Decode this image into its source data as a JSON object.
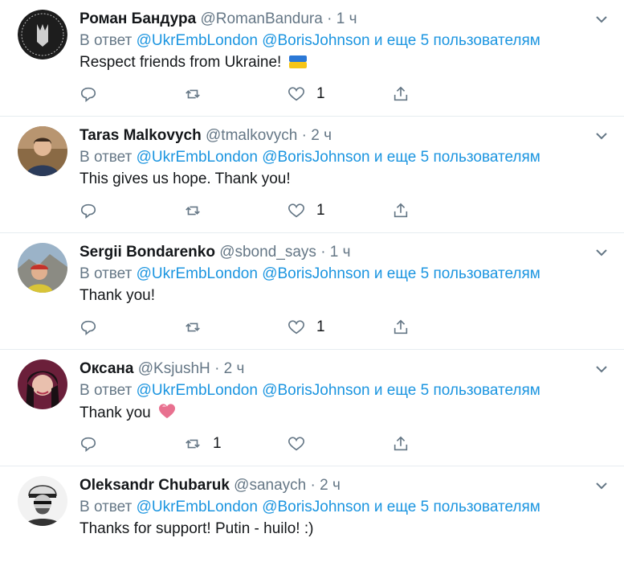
{
  "reply_prefix": "В ответ",
  "reply_mentions": "@UkrEmbLondon @BorisJohnson",
  "reply_suffix": "и еще 5 пользователям",
  "tweets": [
    {
      "name": "Роман Бандура",
      "handle": "@RomanBandura",
      "time": "1 ч",
      "text": "Respect friends from Ukraine!",
      "emoji": "ukraine-flag",
      "retweets": "",
      "likes": "1"
    },
    {
      "name": "Taras Malkovych",
      "handle": "@tmalkovych",
      "time": "2 ч",
      "text": "This gives us hope. Thank you!",
      "retweets": "",
      "likes": "1"
    },
    {
      "name": "Sergii Bondarenko",
      "handle": "@sbond_says",
      "time": "1 ч",
      "text": "Thank you!",
      "retweets": "",
      "likes": "1"
    },
    {
      "name": "Оксана",
      "handle": "@KsjushH",
      "time": "2 ч",
      "text": "Thank you",
      "emoji": "pink-heart",
      "retweets": "1",
      "likes": ""
    },
    {
      "name": "Oleksandr Chubaruk",
      "handle": "@sanaych",
      "time": "2 ч",
      "text": "Thanks for support! Putin - huilo! :)",
      "retweets": "",
      "likes": ""
    }
  ],
  "colors": {
    "link": "#1b95e0",
    "muted": "#657786",
    "icon": "#657786",
    "divider": "#e6ecf0"
  },
  "dot": "·"
}
